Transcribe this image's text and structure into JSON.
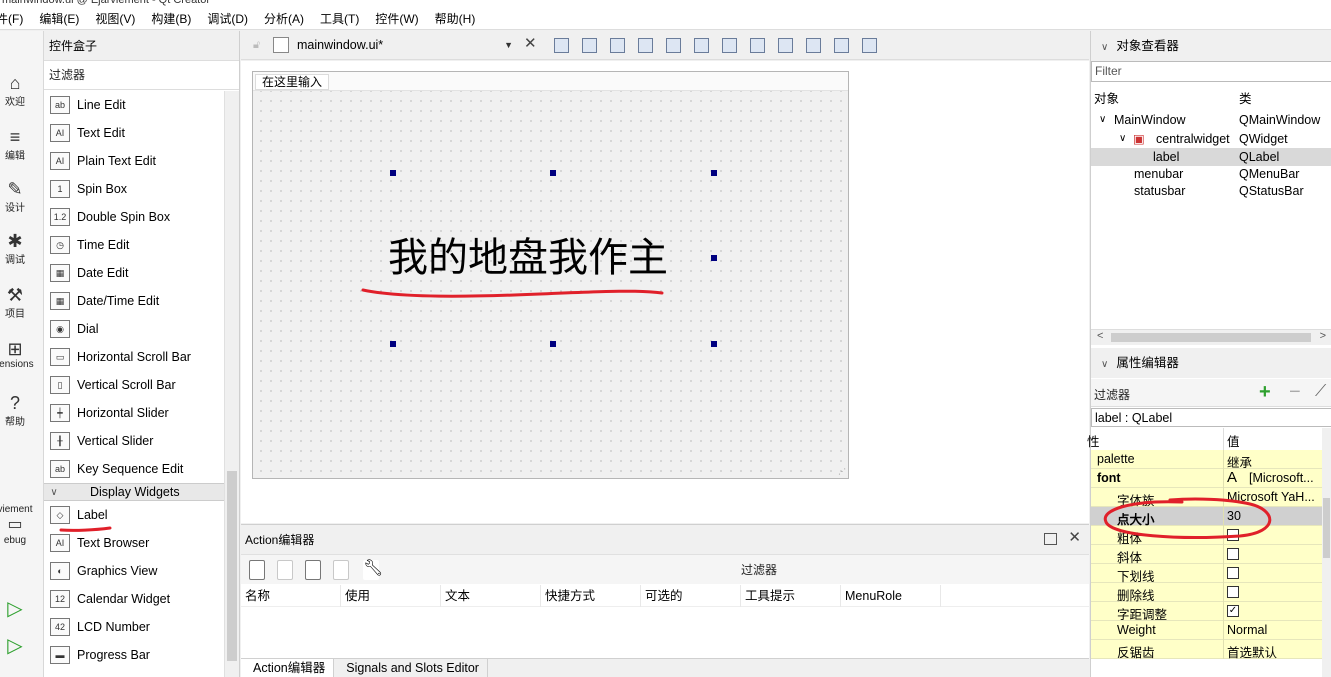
{
  "window": {
    "title": "mainwindow.ui @ Ejarviement - Qt Creator"
  },
  "menubar": [
    "件(F)",
    "编辑(E)",
    "视图(V)",
    "构建(B)",
    "调试(D)",
    "分析(A)",
    "工具(T)",
    "控件(W)",
    "帮助(H)"
  ],
  "modes": [
    {
      "label": "欢迎",
      "icon": "⌂"
    },
    {
      "label": "编辑",
      "icon": "≡"
    },
    {
      "label": "设计",
      "icon": "✎"
    },
    {
      "label": "调试",
      "icon": "✱"
    },
    {
      "label": "项目",
      "icon": "⚒"
    },
    {
      "label": "tensions",
      "icon": "⊞"
    },
    {
      "label": "帮助",
      "icon": "?"
    }
  ],
  "kit": {
    "label": "viement",
    "build": "ebug"
  },
  "widget_box": {
    "title": "控件盒子",
    "filter": "过滤器",
    "items_before": [
      {
        "label": "Line Edit",
        "icon": "ab"
      },
      {
        "label": "Text Edit",
        "icon": "AI"
      },
      {
        "label": "Plain Text Edit",
        "icon": "AI"
      },
      {
        "label": "Spin Box",
        "icon": "1"
      },
      {
        "label": "Double Spin Box",
        "icon": "1.2"
      },
      {
        "label": "Time Edit",
        "icon": "◷"
      },
      {
        "label": "Date Edit",
        "icon": "▦"
      },
      {
        "label": "Date/Time Edit",
        "icon": "▦"
      },
      {
        "label": "Dial",
        "icon": "◉"
      },
      {
        "label": "Horizontal Scroll Bar",
        "icon": "▭"
      },
      {
        "label": "Vertical Scroll Bar",
        "icon": "▯"
      },
      {
        "label": "Horizontal Slider",
        "icon": "┿"
      },
      {
        "label": "Vertical Slider",
        "icon": "╂"
      },
      {
        "label": "Key Sequence Edit",
        "icon": "ab"
      }
    ],
    "category": "Display Widgets",
    "items_after": [
      {
        "label": "Label",
        "icon": "◇"
      },
      {
        "label": "Text Browser",
        "icon": "AI"
      },
      {
        "label": "Graphics View",
        "icon": "◐"
      },
      {
        "label": "Calendar Widget",
        "icon": "12"
      },
      {
        "label": "LCD Number",
        "icon": "42"
      },
      {
        "label": "Progress Bar",
        "icon": "▬"
      }
    ]
  },
  "editor": {
    "document": "mainwindow.ui*",
    "form_menu_placeholder": "在这里输入",
    "label_text": "我的地盘我作主"
  },
  "action_editor": {
    "title": "Action编辑器",
    "filter": "过滤器",
    "columns": [
      "名称",
      "使用",
      "文本",
      "快捷方式",
      "可选的",
      "工具提示",
      "MenuRole"
    ],
    "tabs": [
      "Action编辑器",
      "Signals and Slots Editor"
    ]
  },
  "object_inspector": {
    "title": "对象查看器",
    "filter_placeholder": "Filter",
    "col_object": "对象",
    "col_class": "类",
    "rows": [
      {
        "object": "MainWindow",
        "class": "QMainWindow",
        "indent": 0,
        "toggle": "∨"
      },
      {
        "object": "centralwidget",
        "class": "QWidget",
        "indent": 1,
        "toggle": "∨"
      },
      {
        "object": "label",
        "class": "QLabel",
        "indent": 2,
        "toggle": ""
      },
      {
        "object": "menubar",
        "class": "QMenuBar",
        "indent": 1,
        "toggle": ""
      },
      {
        "object": "statusbar",
        "class": "QStatusBar",
        "indent": 1,
        "toggle": ""
      }
    ]
  },
  "property_editor": {
    "title": "属性编辑器",
    "filter": "过滤器",
    "object_line": "label : QLabel",
    "col_property": "性",
    "col_value": "值",
    "rows": [
      {
        "key": "palette",
        "value": "继承",
        "indent": 0,
        "bold": false
      },
      {
        "key": "font",
        "value": "[Microsoft...",
        "indent": 0,
        "bold": true,
        "icon": "A"
      },
      {
        "key": "字体族",
        "value": "Microsoft YaH...",
        "indent": 1,
        "bold": false
      },
      {
        "key": "点大小",
        "value": "30",
        "indent": 1,
        "bold": true,
        "selected": true
      },
      {
        "key": "粗体",
        "check": false,
        "indent": 1
      },
      {
        "key": "斜体",
        "check": false,
        "indent": 1
      },
      {
        "key": "下划线",
        "check": false,
        "indent": 1
      },
      {
        "key": "删除线",
        "check": false,
        "indent": 1
      },
      {
        "key": "字距调整",
        "check": true,
        "indent": 1
      },
      {
        "key": "Weight",
        "value": "Normal",
        "indent": 1
      },
      {
        "key": "反锯齿",
        "value": "首选默认",
        "indent": 1
      }
    ]
  },
  "colors": {
    "handle": "#000080",
    "annotation": "#e0202a",
    "property_bg": "#ffffc8",
    "accent_green": "#2ea02e"
  }
}
